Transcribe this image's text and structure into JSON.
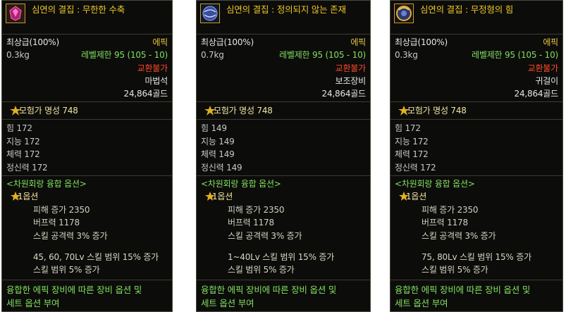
{
  "cards": [
    {
      "title": "심연의 결집 : 무한한 수축",
      "grade": "최상급(100%)",
      "rarity": "에픽",
      "weight": "0.3kg",
      "level_limit": "레벨제한 95 (105 - 10)",
      "trade": "교환불가",
      "slot": "마법석",
      "price": "24,864골드",
      "reputation": "모험가 명성 748",
      "stats": [
        "힘 172",
        "지능 172",
        "체력 172",
        "정신력 172"
      ],
      "fusion_header": "<차원회랑 융합 옵션>",
      "option_title": "1옵션",
      "options": [
        "피해 증가 2350",
        "버프력 1178",
        "스킬 공격력 3% 증가"
      ],
      "extra": [
        "45, 60, 70Lv 스킬 범위 15% 증가",
        "스킬 범위 5% 증가"
      ],
      "footer": [
        "융합한 에픽 장비에 따른 장비 옵션 및",
        "세트 옵션 부여"
      ],
      "icon": "purple-gem-icon"
    },
    {
      "title": "심연의 결집 : 정의되지 않는 존재",
      "grade": "최상급(100%)",
      "rarity": "에픽",
      "weight": "0.7kg",
      "level_limit": "레벨제한 95 (105 - 10)",
      "trade": "교환불가",
      "slot": "보조장비",
      "price": "24,864골드",
      "reputation": "모험가 명성 748",
      "stats": [
        "힘 149",
        "지능 149",
        "체력 149",
        "정신력 149"
      ],
      "fusion_header": "<차원회랑 융합 옵션>",
      "option_title": "1옵션",
      "options": [
        "피해 증가 2350",
        "버프력 1178",
        "스킬 공격력 3% 증가"
      ],
      "extra": [
        "1~40Lv 스킬 범위 15% 증가",
        "스킬 범위 5% 증가"
      ],
      "footer": [
        "융합한 에픽 장비에 따른 장비 옵션 및",
        "세트 옵션 부여"
      ],
      "icon": "blue-orb-icon"
    },
    {
      "title": "심연의 결집 : 무정형의 힘",
      "grade": "최상급(100%)",
      "rarity": "에픽",
      "weight": "0.3kg",
      "level_limit": "레벨제한 95 (105 - 10)",
      "trade": "교환불가",
      "slot": "귀걸이",
      "price": "24,864골드",
      "reputation": "모험가 명성 748",
      "stats": [
        "힘 172",
        "지능 172",
        "체력 172",
        "정신력 172"
      ],
      "fusion_header": "<차원회랑 융합 옵션>",
      "option_title": "1옵션",
      "options": [
        "피해 증가 2350",
        "버프력 1178",
        "스킬 공격력 3% 증가"
      ],
      "extra": [
        "75, 80Lv 스킬 범위 15% 증가",
        "스킬 범위 5% 증가"
      ],
      "footer": [
        "융합한 에픽 장비에 따른 장비 옵션 및",
        "세트 옵션 부여"
      ],
      "icon": "gold-orb-icon"
    }
  ]
}
